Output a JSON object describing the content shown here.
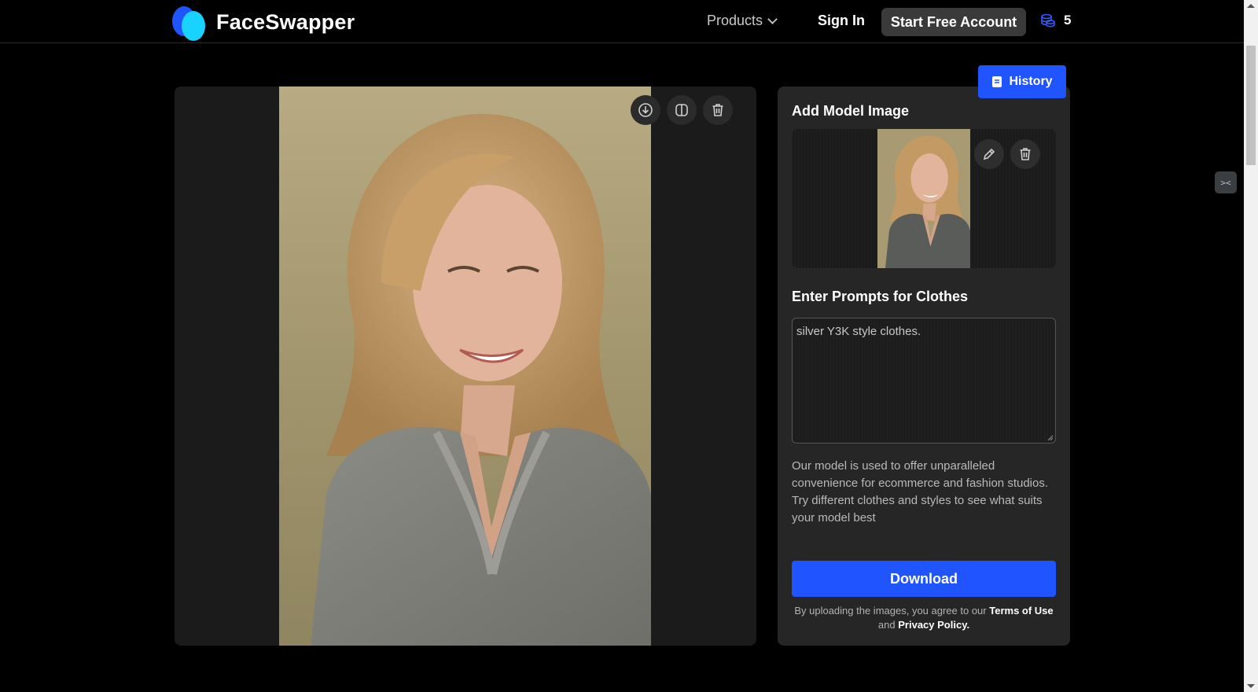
{
  "header": {
    "logo_text": "FaceSwapper",
    "nav_products": "Products",
    "sign_in": "Sign In",
    "start_account": "Start Free Account",
    "credits": "5"
  },
  "preview": {
    "actions": [
      "download-icon",
      "compare-icon",
      "trash-icon"
    ]
  },
  "panel": {
    "history_label": "History",
    "model_title": "Add Model Image",
    "prompt_title": "Enter Prompts for Clothes",
    "prompt_value": "silver Y3K style clothes.",
    "description": "Our model is used to offer unparalleled convenience for ecommerce and fashion studios. Try different clothes and styles to see what suits your model best",
    "download_label": "Download",
    "terms_prefix": "By uploading the images, you agree to our",
    "terms_link": "Terms of Use",
    "terms_and": "and",
    "privacy_link": "Privacy Policy."
  },
  "side_widget": "><",
  "colors": {
    "accent": "#1f54ff",
    "logo_light": "#18d2ff",
    "panel_bg": "#262626",
    "preview_bg": "#1b1b1b"
  }
}
